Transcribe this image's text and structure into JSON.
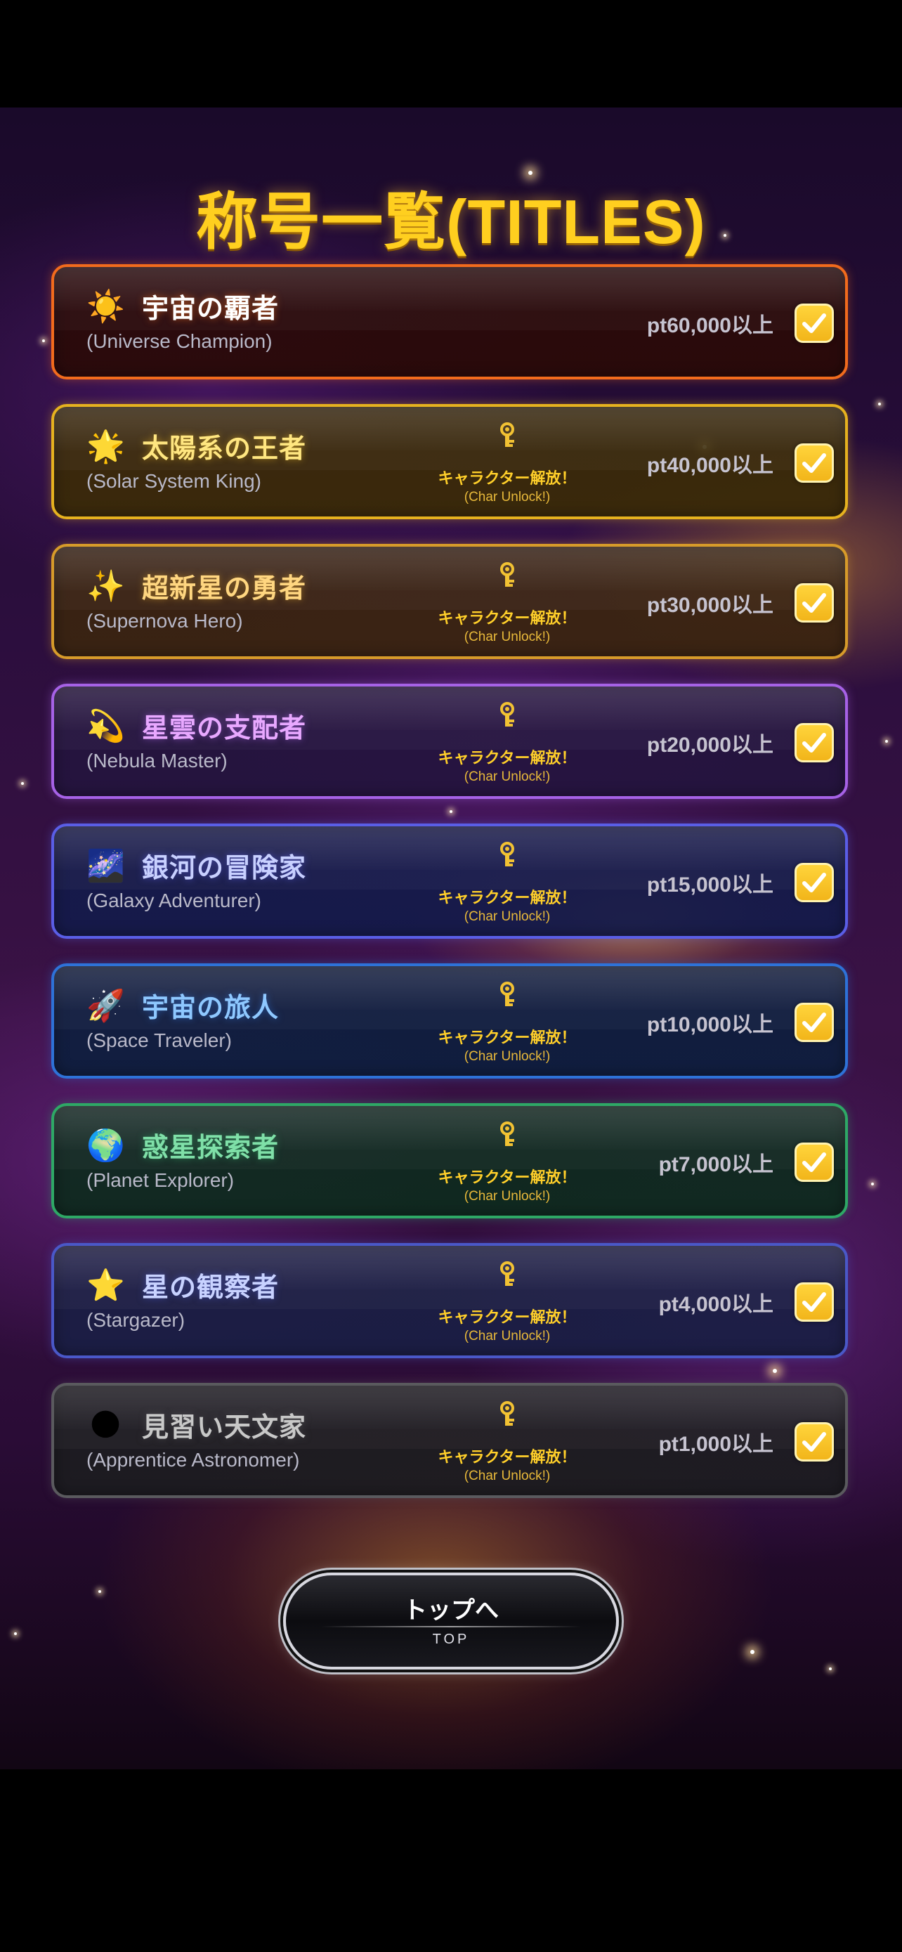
{
  "page": {
    "title": "称号一覧(TITLES)"
  },
  "titles": [
    {
      "icon": "sun-icon",
      "emoji": "☀️",
      "name_jp": "宇宙の覇者",
      "name_en": "(Universe Champion)",
      "points": "pt60,000以上",
      "unlock": false,
      "checked": true,
      "accent": "#f26b1d",
      "bg": "#2a0a08",
      "text": "#ffffff"
    },
    {
      "icon": "glowing-star-icon",
      "emoji": "🌟",
      "name_jp": "太陽系の王者",
      "name_en": "(Solar System King)",
      "points": "pt40,000以上",
      "unlock": true,
      "unlock_jp": "キャラクター解放！",
      "unlock_en": "(Char Unlock!)",
      "checked": true,
      "accent": "#e6b21f",
      "bg": "#3a2a08",
      "text": "#ffe680"
    },
    {
      "icon": "sparkles-icon",
      "emoji": "✨",
      "name_jp": "超新星の勇者",
      "name_en": "(Supernova Hero)",
      "points": "pt30,000以上",
      "unlock": true,
      "unlock_jp": "キャラクター解放！",
      "unlock_en": "(Char Unlock!)",
      "checked": true,
      "accent": "#d79b2a",
      "bg": "#3a2410",
      "text": "#ffd680"
    },
    {
      "icon": "dizzy-star-icon",
      "emoji": "💫",
      "name_jp": "星雲の支配者",
      "name_en": "(Nebula Master)",
      "points": "pt20,000以上",
      "unlock": true,
      "unlock_jp": "キャラクター解放！",
      "unlock_en": "(Char Unlock!)",
      "checked": true,
      "accent": "#a662e6",
      "bg": "#24143e",
      "text": "#e8a8ff"
    },
    {
      "icon": "milky-way-icon",
      "emoji": "🌌",
      "name_jp": "銀河の冒険家",
      "name_en": "(Galaxy Adventurer)",
      "points": "pt15,000以上",
      "unlock": true,
      "unlock_jp": "キャラクター解放！",
      "unlock_en": "(Char Unlock!)",
      "checked": true,
      "accent": "#5a5ee6",
      "bg": "#141a4a",
      "text": "#c8d0ff"
    },
    {
      "icon": "rocket-icon",
      "emoji": "🚀",
      "name_jp": "宇宙の旅人",
      "name_en": "(Space Traveler)",
      "points": "pt10,000以上",
      "unlock": true,
      "unlock_jp": "キャラクター解放！",
      "unlock_en": "(Char Unlock!)",
      "checked": true,
      "accent": "#2e72d8",
      "bg": "#0e1e3e",
      "text": "#8ec8ff"
    },
    {
      "icon": "globe-icon",
      "emoji": "🌍",
      "name_jp": "惑星探索者",
      "name_en": "(Planet Explorer)",
      "points": "pt7,000以上",
      "unlock": true,
      "unlock_jp": "キャラクター解放！",
      "unlock_en": "(Char Unlock!)",
      "checked": true,
      "accent": "#2ea866",
      "bg": "#0e2a1e",
      "text": "#7fe0a8"
    },
    {
      "icon": "star-icon",
      "emoji": "⭐",
      "name_jp": "星の観察者",
      "name_en": "(Stargazer)",
      "points": "pt4,000以上",
      "unlock": true,
      "unlock_jp": "キャラクター解放！",
      "unlock_en": "(Char Unlock!)",
      "checked": true,
      "accent": "#4a58c8",
      "bg": "#1a1e44",
      "text": "#c8d2ff"
    },
    {
      "icon": "moon-icon",
      "emoji": "🌑",
      "name_jp": "見習い天文家",
      "name_en": "(Apprentice Astronomer)",
      "points": "pt1,000以上",
      "unlock": true,
      "unlock_jp": "キャラクター解放！",
      "unlock_en": "(Char Unlock!)",
      "checked": true,
      "accent": "#5a5a5e",
      "bg": "#1c1c20",
      "text": "#c8c8c8"
    }
  ],
  "top_button": {
    "label_jp": "トップへ",
    "label_en": "TOP"
  }
}
